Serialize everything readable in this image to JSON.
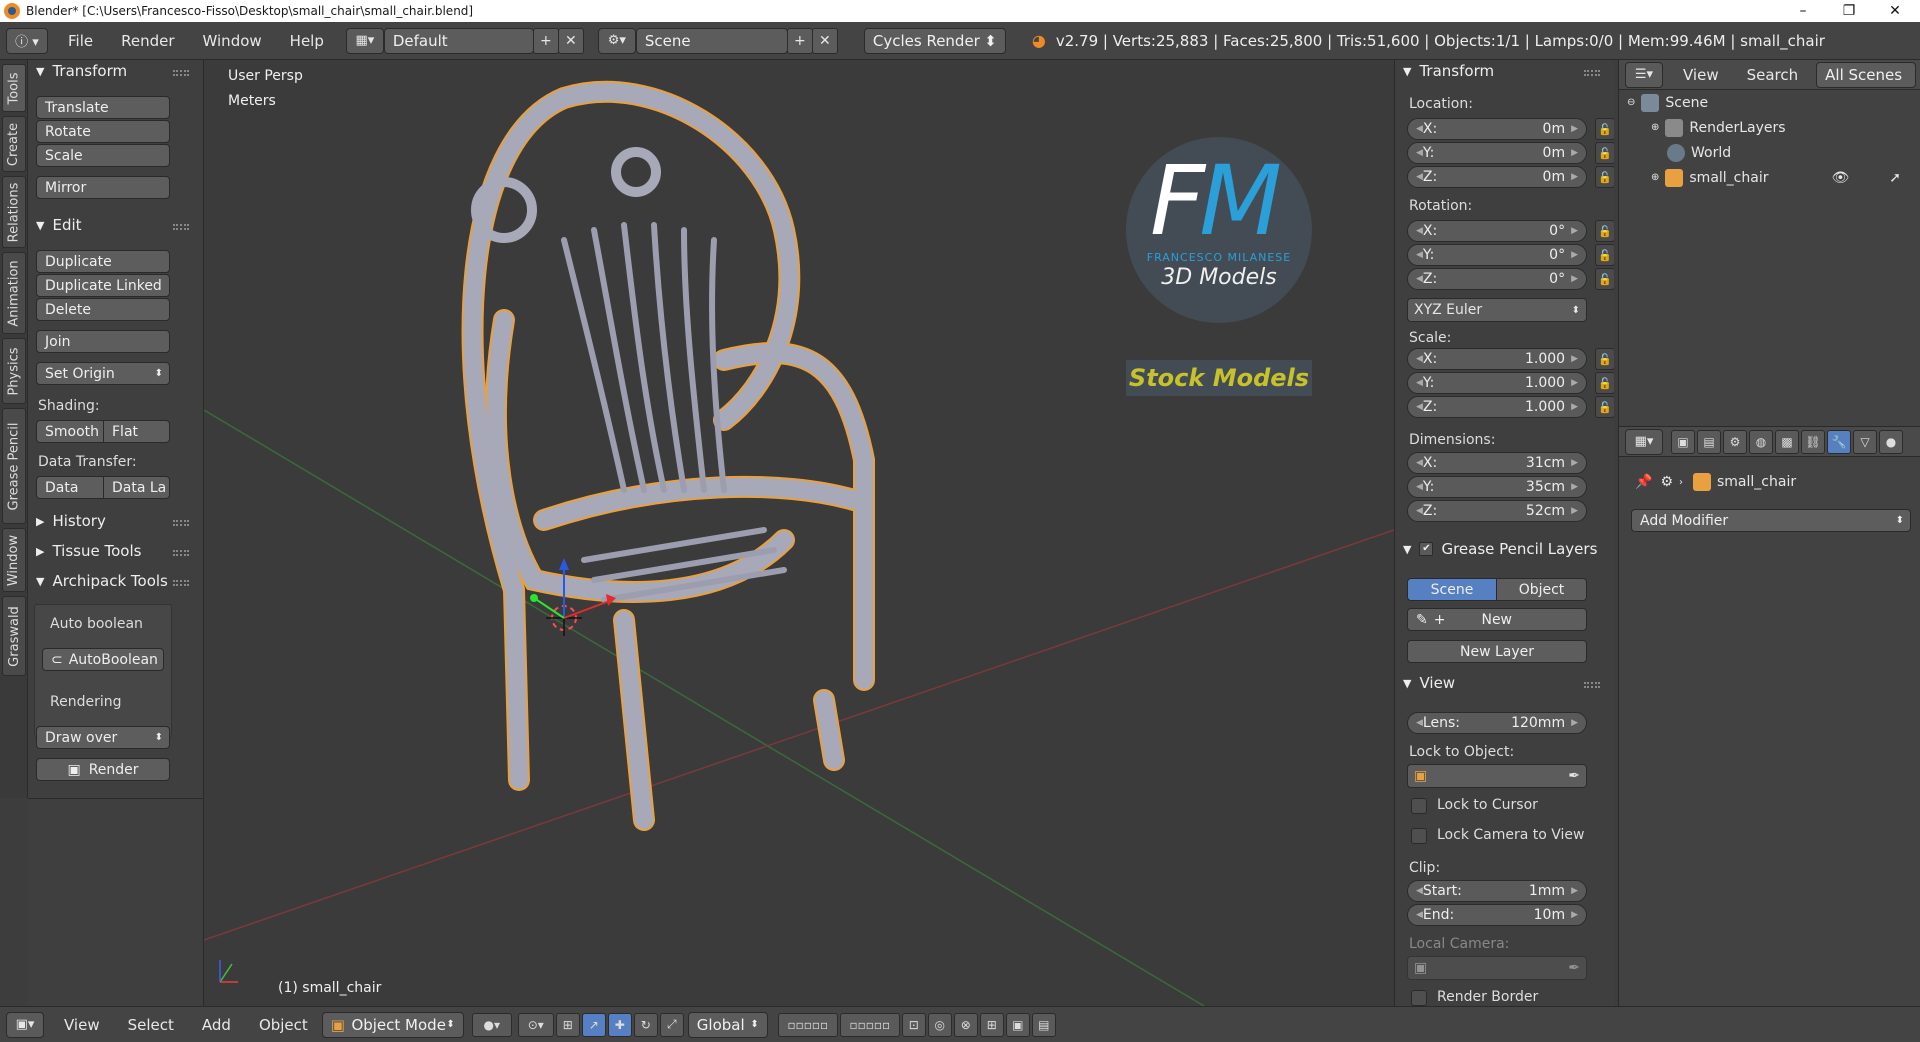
{
  "window": {
    "title": "Blender* [C:\\Users\\Francesco-Fisso\\Desktop\\small_chair\\small_chair.blend]",
    "minimize": "–",
    "maximize": "❐",
    "close": "✕"
  },
  "info_header": {
    "menus": [
      "File",
      "Render",
      "Window",
      "Help"
    ],
    "layout": "Default",
    "scene": "Scene",
    "engine": "Cycles Render",
    "stats": "v2.79 | Verts:25,883 | Faces:25,800 | Tris:51,600 | Objects:1/1 | Lamps:0/0 | Mem:99.46M | small_chair"
  },
  "left_tabs": [
    "Tools",
    "Create",
    "Relations",
    "Animation",
    "Physics",
    "Grease Pencil",
    "Window",
    "Graswald"
  ],
  "toolshelf": {
    "transform": {
      "header": "Transform",
      "buttons": [
        "Translate",
        "Rotate",
        "Scale",
        "Mirror"
      ]
    },
    "edit": {
      "header": "Edit",
      "buttons": [
        "Duplicate",
        "Duplicate Linked",
        "Delete",
        "Join"
      ],
      "set_origin": "Set Origin",
      "shading_label": "Shading:",
      "smooth": "Smooth",
      "flat": "Flat",
      "data_transfer_label": "Data Transfer:",
      "data": "Data",
      "data_la": "Data La"
    },
    "history": "History",
    "tissue": "Tissue Tools",
    "archipack": "Archipack Tools",
    "auto_boolean_label": "Auto boolean",
    "auto_boolean_btn": "AutoBoolean",
    "rendering_label": "Rendering",
    "draw_over": "Draw over",
    "render_btn": "Render"
  },
  "viewport": {
    "view_name": "User Persp",
    "units": "Meters",
    "object_label": "(1) small_chair",
    "watermark": {
      "letters_f": "F",
      "letters_m": "M",
      "brand": "FRANCESCO MILANESE",
      "subtitle": "3D Models",
      "banner": "Stock Models"
    }
  },
  "npanel": {
    "transform_header": "Transform",
    "location_label": "Location:",
    "location": [
      {
        "axis": "X:",
        "value": "0m"
      },
      {
        "axis": "Y:",
        "value": "0m"
      },
      {
        "axis": "Z:",
        "value": "0m"
      }
    ],
    "rotation_label": "Rotation:",
    "rotation": [
      {
        "axis": "X:",
        "value": "0°"
      },
      {
        "axis": "Y:",
        "value": "0°"
      },
      {
        "axis": "Z:",
        "value": "0°"
      }
    ],
    "rotation_mode": "XYZ Euler",
    "scale_label": "Scale:",
    "scale": [
      {
        "axis": "X:",
        "value": "1.000"
      },
      {
        "axis": "Y:",
        "value": "1.000"
      },
      {
        "axis": "Z:",
        "value": "1.000"
      }
    ],
    "dimensions_label": "Dimensions:",
    "dimensions": [
      {
        "axis": "X:",
        "value": "31cm"
      },
      {
        "axis": "Y:",
        "value": "35cm"
      },
      {
        "axis": "Z:",
        "value": "52cm"
      }
    ],
    "gp_header": "Grease Pencil Layers",
    "gp_scene": "Scene",
    "gp_object": "Object",
    "gp_new": "New",
    "gp_new_layer": "New Layer",
    "view_header": "View",
    "lens_label": "Lens:",
    "lens_value": "120mm",
    "lock_to_object": "Lock to Object:",
    "lock_to_cursor": "Lock to Cursor",
    "lock_camera": "Lock Camera to View",
    "clip_label": "Clip:",
    "clip_start_label": "Start:",
    "clip_start": "1mm",
    "clip_end_label": "End:",
    "clip_end": "10m",
    "local_camera": "Local Camera:",
    "render_border": "Render Border"
  },
  "outliner": {
    "menus": [
      "View",
      "Search"
    ],
    "filter": "All Scenes",
    "items": [
      "Scene",
      "RenderLayers",
      "World",
      "small_chair"
    ]
  },
  "properties": {
    "object_name": "small_chair",
    "add_modifier": "Add Modifier"
  },
  "bottom_header": {
    "menus": [
      "View",
      "Select",
      "Add",
      "Object"
    ],
    "mode": "Object Mode",
    "orientation": "Global"
  },
  "colors": {
    "accent": "#5680c2",
    "watermark_blue": "#2a9fd8",
    "banner_text": "#c8c22a",
    "selection_outline": "#f0a030"
  }
}
